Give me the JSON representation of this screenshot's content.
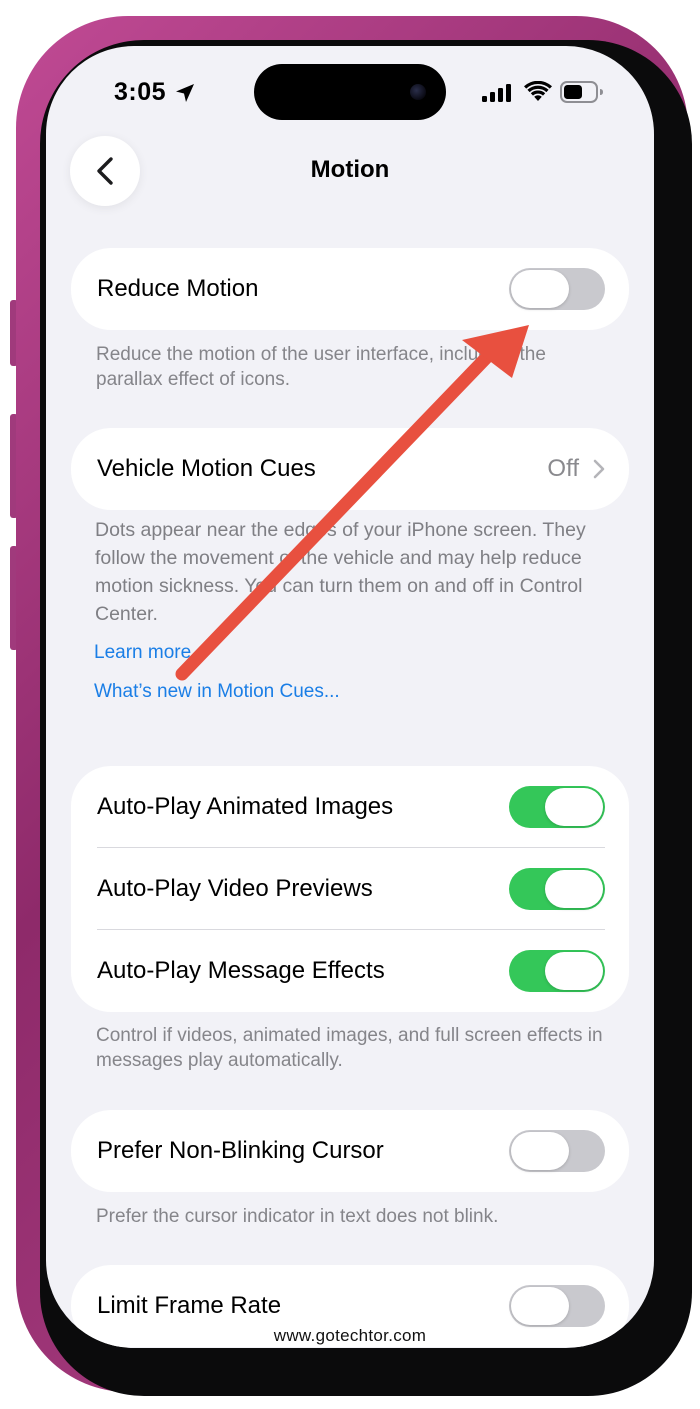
{
  "status_bar": {
    "time": "3:05"
  },
  "nav": {
    "title": "Motion"
  },
  "reduce_motion": {
    "label": "Reduce Motion",
    "enabled": false,
    "footnote": "Reduce the motion of the user interface, including the parallax effect of icons."
  },
  "vehicle_motion_cues": {
    "label": "Vehicle Motion Cues",
    "value": "Off",
    "footnote": "Dots appear near the edges of your iPhone screen. They follow the movement of the vehicle and may help reduce motion sickness. You can turn them on and off in Control Center.",
    "links": [
      "Learn more...",
      "What’s new in Motion Cues..."
    ]
  },
  "autoplay": {
    "items": [
      {
        "label": "Auto-Play Animated Images",
        "enabled": true
      },
      {
        "label": "Auto-Play Video Previews",
        "enabled": true
      },
      {
        "label": "Auto-Play Message Effects",
        "enabled": true
      }
    ],
    "footnote": "Control if videos, animated images, and full screen effects in messages play automatically."
  },
  "non_blinking_cursor": {
    "label": "Prefer Non-Blinking Cursor",
    "enabled": false,
    "footnote": "Prefer the cursor indicator in text does not blink."
  },
  "limit_frame_rate": {
    "label": "Limit Frame Rate",
    "enabled": false
  },
  "watermark": "www.gotechtor.com",
  "colors": {
    "toggle_on": "#34c759",
    "toggle_off": "#c9c9ce",
    "link": "#1a7ee6",
    "annotation_arrow": "#e8503f",
    "background": "#f2f2f7",
    "phone_frame": "#b24488"
  },
  "icons": [
    "location-arrow-icon",
    "cellular-signal-icon",
    "wifi-icon",
    "battery-icon",
    "chevron-left-icon",
    "chevron-right-icon",
    "annotation-arrow"
  ]
}
